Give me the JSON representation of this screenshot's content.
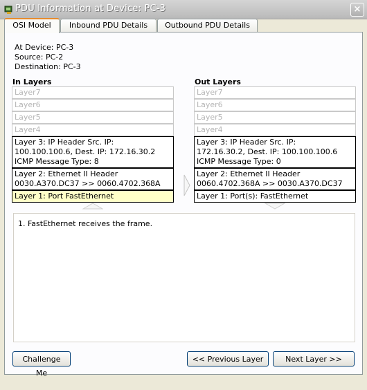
{
  "window": {
    "title": "PDU Information at Device: PC-3",
    "close_glyph": "×"
  },
  "tabs": [
    {
      "label": "OSI Model"
    },
    {
      "label": "Inbound PDU Details"
    },
    {
      "label": "Outbound PDU Details"
    }
  ],
  "device_info": {
    "at_device": "At Device: PC-3",
    "source": "Source: PC-2",
    "destination": "Destination: PC-3"
  },
  "in_layers": {
    "header": "In Layers",
    "layer7": "Layer7",
    "layer6": "Layer6",
    "layer5": "Layer5",
    "layer4": "Layer4",
    "layer3": {
      "line1": "Layer 3: IP Header Src. IP:",
      "line2": "100.100.100.6, Dest. IP: 172.16.30.2",
      "line3": "ICMP Message Type: 8"
    },
    "layer2": {
      "line1": "Layer 2: Ethernet II Header",
      "line2": "0030.A370.DC37 >> 0060.4702.368A"
    },
    "layer1": "Layer 1: Port FastEthernet"
  },
  "out_layers": {
    "header": "Out Layers",
    "layer7": "Layer7",
    "layer6": "Layer6",
    "layer5": "Layer5",
    "layer4": "Layer4",
    "layer3": {
      "line1": "Layer 3: IP Header Src. IP:",
      "line2": "172.16.30.2, Dest. IP: 100.100.100.6",
      "line3": "ICMP Message Type: 0"
    },
    "layer2": {
      "line1": "Layer 2: Ethernet II Header",
      "line2": "0060.4702.368A >> 0030.A370.DC37"
    },
    "layer1": "Layer 1: Port(s): FastEthernet"
  },
  "description": "1. FastEthernet receives the frame.",
  "buttons": {
    "challenge": "Challenge Me",
    "previous": "<< Previous Layer",
    "next": "Next Layer >>"
  },
  "colors": {
    "highlight": "#ffffc8",
    "tab_accent": "#e68b2c"
  }
}
